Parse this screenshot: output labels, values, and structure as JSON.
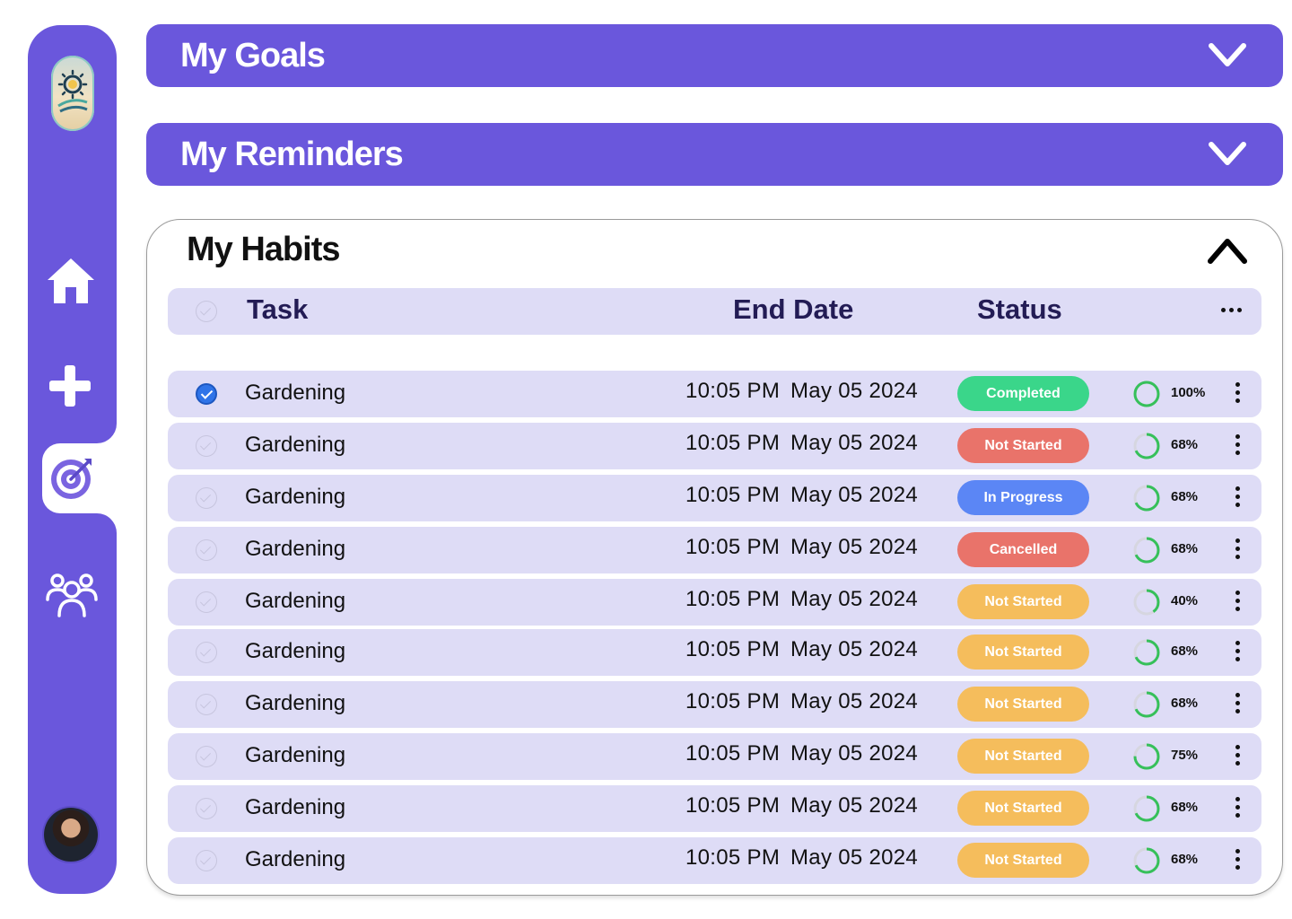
{
  "sidebar": {
    "items": [
      {
        "name": "home-icon"
      },
      {
        "name": "plus-icon"
      },
      {
        "name": "target-icon",
        "active": true
      },
      {
        "name": "people-icon"
      }
    ]
  },
  "goals": {
    "title": "My Goals"
  },
  "reminders": {
    "title": "My Reminders"
  },
  "habits": {
    "title": "My Habits",
    "columns": {
      "task": "Task",
      "end_date": "End Date",
      "status": "Status"
    },
    "rows": [
      {
        "task": "Gardening",
        "time": "10:05 PM",
        "date": "May 05 2024",
        "status": "Completed",
        "status_color": "#3ad68a",
        "progress": 100,
        "progress_label": "100%",
        "checked": true
      },
      {
        "task": "Gardening",
        "time": "10:05 PM",
        "date": "May 05 2024",
        "status": "Not Started",
        "status_color": "#e9736a",
        "progress": 68,
        "progress_label": "68%",
        "checked": false
      },
      {
        "task": "Gardening",
        "time": "10:05 PM",
        "date": "May 05 2024",
        "status": "In Progress",
        "status_color": "#5b86f5",
        "progress": 68,
        "progress_label": "68%",
        "checked": false
      },
      {
        "task": "Gardening",
        "time": "10:05 PM",
        "date": "May 05 2024",
        "status": "Cancelled",
        "status_color": "#e9736a",
        "progress": 68,
        "progress_label": "68%",
        "checked": false
      },
      {
        "task": "Gardening",
        "time": "10:05 PM",
        "date": "May 05 2024",
        "status": "Not Started",
        "status_color": "#f5bd5c",
        "progress": 40,
        "progress_label": "40%",
        "checked": false
      },
      {
        "task": "Gardening",
        "time": "10:05 PM",
        "date": "May 05 2024",
        "status": "Not Started",
        "status_color": "#f5bd5c",
        "progress": 68,
        "progress_label": "68%",
        "checked": false
      },
      {
        "task": "Gardening",
        "time": "10:05 PM",
        "date": "May 05 2024",
        "status": "Not Started",
        "status_color": "#f5bd5c",
        "progress": 68,
        "progress_label": "68%",
        "checked": false
      },
      {
        "task": "Gardening",
        "time": "10:05 PM",
        "date": "May 05 2024",
        "status": "Not Started",
        "status_color": "#f5bd5c",
        "progress": 75,
        "progress_label": "75%",
        "checked": false
      },
      {
        "task": "Gardening",
        "time": "10:05 PM",
        "date": "May 05 2024",
        "status": "Not Started",
        "status_color": "#f5bd5c",
        "progress": 68,
        "progress_label": "68%",
        "checked": false
      },
      {
        "task": "Gardening",
        "time": "10:05 PM",
        "date": "May 05 2024",
        "status": "Not Started",
        "status_color": "#f5bd5c",
        "progress": 68,
        "progress_label": "68%",
        "checked": false
      }
    ]
  },
  "colors": {
    "accent": "#6a57dc",
    "row_bg": "#dedcf6",
    "progress": "#36c05a"
  }
}
